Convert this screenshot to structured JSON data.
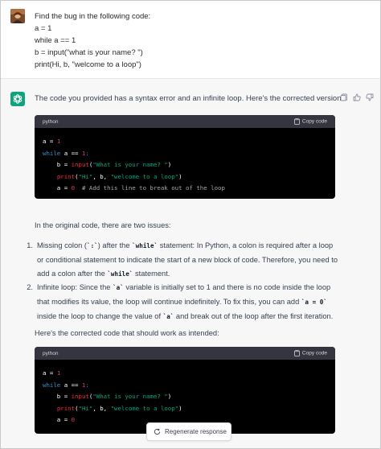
{
  "user": {
    "lines": [
      "Find the bug in the following code:",
      "a = 1",
      "while a == 1",
      "b = input(\"what is your name? \")",
      "print(Hi, b, \"welcome to a loop\")"
    ]
  },
  "assistant": {
    "intro": "The code you provided has a syntax error and an infinite loop. Here's the corrected version:",
    "code_block_1": {
      "language": "python",
      "copy_label": "Copy code",
      "lines": [
        "a = 1",
        "while a == 1:",
        "    b = input(\"What is your name? \")",
        "    print(\"Hi\", b, \"welcome to a loop\")",
        "    a = 0  # Add this line to break out of the loop"
      ]
    },
    "issues_intro": "In the original code, there are two issues:",
    "issues": [
      {
        "number": "1.",
        "lines": [
          "Missing colon (`:`) after the `while` statement: In Python, a colon is required after a loop",
          "or conditional statement to indicate the start of a new block of code. Therefore, you need to",
          "add a colon after the `while` statement."
        ]
      },
      {
        "number": "2.",
        "lines": [
          "Infinite loop: Since the `a` variable is initially set to 1 and there is no code inside the loop",
          "that modifies its value, the loop will continue indefinitely. To fix this, you can add `a = 0`",
          "inside the loop to change the value of `a` and break out of the loop after the first iteration."
        ]
      }
    ],
    "corrected_intro": "Here's the corrected code that should work as intended:",
    "code_block_2": {
      "language": "python",
      "copy_label": "Copy code",
      "lines": [
        "a = 1",
        "while a == 1:",
        "    b = input(\"What is your name? \")",
        "    print(\"Hi\", b, \"welcome to a loop\")",
        "    a = 0"
      ]
    }
  },
  "regenerate_label": "Regenerate response",
  "colors": {
    "assistant_bg": "#f7f7f8",
    "logo_green": "#10a37f",
    "code_bg": "#000000",
    "code_header": "#343541",
    "keyword": "#2e95d3",
    "string": "#00a67d",
    "number": "#df3079"
  },
  "icons": [
    "user-avatar",
    "chatgpt-logo-icon",
    "copy-icon",
    "thumbs-up-icon",
    "thumbs-down-icon",
    "clipboard-icon",
    "refresh-icon"
  ]
}
